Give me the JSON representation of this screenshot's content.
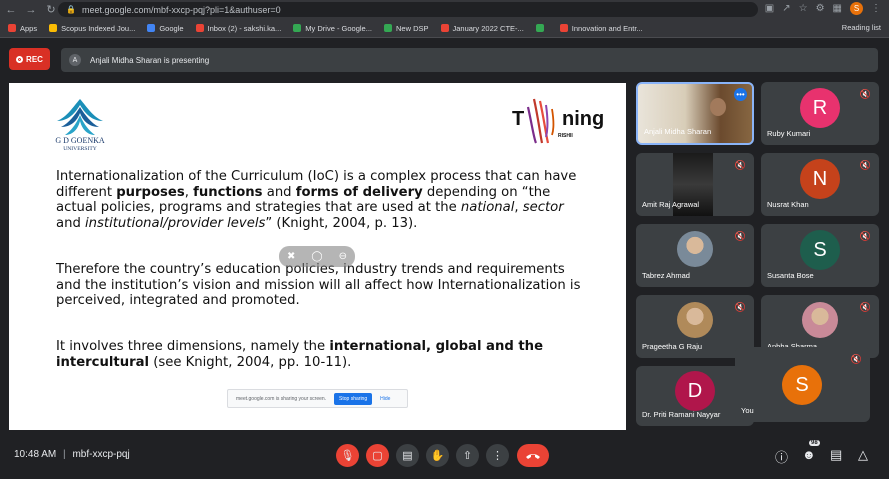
{
  "browser": {
    "url": "meet.google.com/mbf-xxcp-pqj?pli=1&authuser=0",
    "profile_letter": "S"
  },
  "bookmarks": [
    "Apps",
    "Scopus Indexed Jou...",
    "Google",
    "Inbox (2) - sakshi.ka...",
    "My Drive - Google...",
    "New DSP",
    "January 2022 CTE-...",
    "",
    "Innovation and Entr..."
  ],
  "reading_list": "Reading list",
  "rec_label": "REC",
  "presenting_text": "Anjali Midha Sharan is presenting",
  "presenter_avatar": "A",
  "slide": {
    "logo_line1": "G D GOENKA",
    "logo_line2": "UNIVERSITY",
    "tuning_t": "T",
    "tuning_ning": "ning",
    "tuning_sub": "RISHII",
    "p1": [
      {
        "t": "Internationalization of the Curriculum (IoC) is a complex process that can have different ",
        "s": "n"
      },
      {
        "t": "purposes",
        "s": "b"
      },
      {
        "t": ", ",
        "s": "n"
      },
      {
        "t": "functions",
        "s": "b"
      },
      {
        "t": " and ",
        "s": "n"
      },
      {
        "t": "forms of delivery",
        "s": "b"
      },
      {
        "t": " depending on “the actual policies, programs and strategies that are used at the ",
        "s": "n"
      },
      {
        "t": "national",
        "s": "i"
      },
      {
        "t": ", ",
        "s": "n"
      },
      {
        "t": "sector",
        "s": "i"
      },
      {
        "t": " and ",
        "s": "n"
      },
      {
        "t": "institutional/provider levels",
        "s": "i"
      },
      {
        "t": "” (Knight, 2004, p. 13).",
        "s": "n"
      }
    ],
    "p2": [
      {
        "t": "Therefore the country’s education policies, industry trends and requirements and the institution’s vision and mission will all affect how Internationalization is perceived, integrated and promoted.",
        "s": "n"
      }
    ],
    "p3": [
      {
        "t": "It involves three dimensions, namely the ",
        "s": "n"
      },
      {
        "t": "international, global and the intercultural",
        "s": "b"
      },
      {
        "t": " (see Knight, 2004, pp. 10-11).",
        "s": "n"
      }
    ]
  },
  "share_bar": {
    "text": "meet.google.com is sharing your screen.",
    "stop": "Stop sharing",
    "hide": "Hide"
  },
  "participants": [
    {
      "name": "Anjali Midha Sharan",
      "letter": "",
      "color": "",
      "kind": "video"
    },
    {
      "name": "Ruby Kumari",
      "letter": "R",
      "color": "#e8326e",
      "kind": "letter"
    },
    {
      "name": "Amit Raj Agrawal",
      "letter": "",
      "color": "",
      "kind": "darkvideo"
    },
    {
      "name": "Nusrat Khan",
      "letter": "N",
      "color": "#c5421b",
      "kind": "letter"
    },
    {
      "name": "Tabrez Ahmad",
      "letter": "",
      "color": "#7a8a99",
      "kind": "photo"
    },
    {
      "name": "Susanta Bose",
      "letter": "S",
      "color": "#1e5e4d",
      "kind": "letter"
    },
    {
      "name": "Prageetha G Raju",
      "letter": "",
      "color": "#b08a5a",
      "kind": "photo"
    },
    {
      "name": "Anbha Sharma",
      "letter": "",
      "color": "#c98a98",
      "kind": "photo"
    },
    {
      "name": "Dr. Priti Ramani Nayyar",
      "letter": "D",
      "color": "#b0164b",
      "kind": "letter"
    }
  ],
  "self": {
    "name": "You",
    "letter": "S",
    "color": "#e8710a"
  },
  "bottom": {
    "time": "10:48 AM",
    "separator": "|",
    "meeting_code": "mbf-xxcp-pqj",
    "people_count": "98"
  }
}
